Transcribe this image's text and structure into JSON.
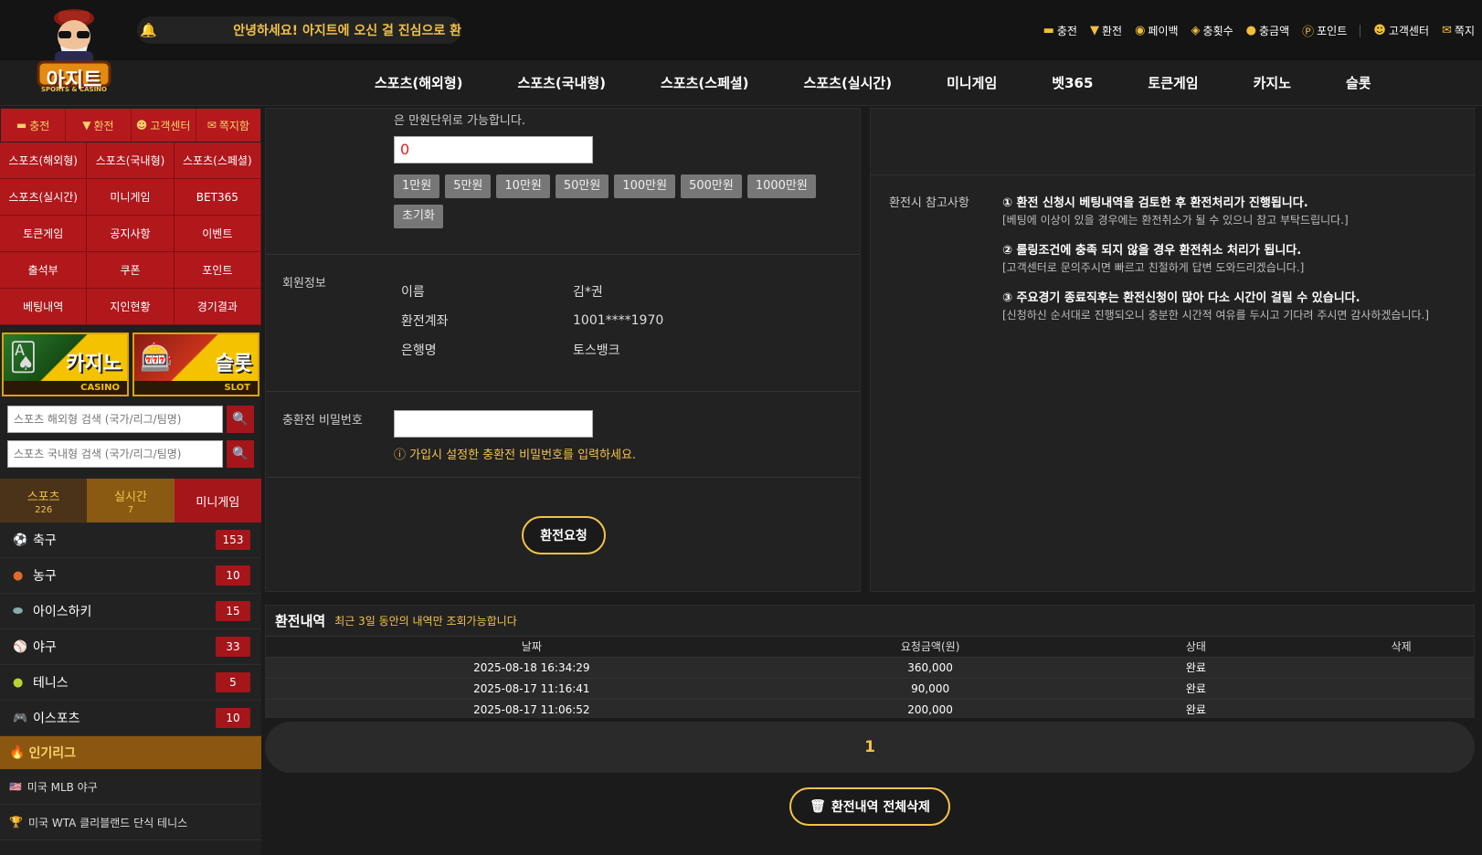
{
  "header": {
    "logo_text": "아지트",
    "logo_sub": "SPORTS & CASINO",
    "notice": "안녕하세요! 아지트에 오신 걸 진심으로 환",
    "top_links": [
      {
        "label": "충전",
        "icon": "card-icon"
      },
      {
        "label": "환전",
        "icon": "exchange-icon"
      },
      {
        "label": "페이백",
        "icon": "payback-icon"
      },
      {
        "label": "충횟수",
        "icon": "count-icon"
      },
      {
        "label": "충금액",
        "icon": "coins-icon"
      },
      {
        "label": "포인트",
        "icon": "point-icon"
      },
      {
        "label": "고객센터",
        "icon": "support-icon"
      },
      {
        "label": "쪽지",
        "icon": "message-icon"
      }
    ]
  },
  "nav": [
    "스포츠(해외형)",
    "스포츠(국내형)",
    "스포츠(스페셜)",
    "스포츠(실시간)",
    "미니게임",
    "벳365",
    "토큰게임",
    "카지노",
    "슬롯"
  ],
  "sidebar": {
    "quick": [
      "충전",
      "환전",
      "고객센터",
      "쪽지함"
    ],
    "menu": [
      "스포츠(해외형)",
      "스포츠(국내형)",
      "스포츠(스페셜)",
      "스포츠(실시간)",
      "미니게임",
      "BET365",
      "토큰게임",
      "공지사항",
      "이벤트",
      "출석부",
      "쿠폰",
      "포인트",
      "베팅내역",
      "지인현황",
      "경기결과"
    ],
    "banner_casino": {
      "title": "카지노",
      "sub": "CASINO"
    },
    "banner_slot": {
      "title": "슬롯",
      "sub": "SLOT"
    },
    "search_overseas_placeholder": "스포츠 해외형 검색 (국가/리그/팀명)",
    "search_domestic_placeholder": "스포츠 국내형 검색 (국가/리그/팀명)",
    "tabs": [
      {
        "label": "스포츠",
        "count": "226"
      },
      {
        "label": "실시간",
        "count": "7"
      },
      {
        "label": "미니게임",
        "count": ""
      }
    ],
    "sports": [
      {
        "name": "축구",
        "count": "153"
      },
      {
        "name": "농구",
        "count": "10"
      },
      {
        "name": "아이스하키",
        "count": "15"
      },
      {
        "name": "야구",
        "count": "33"
      },
      {
        "name": "테니스",
        "count": "5"
      },
      {
        "name": "이스포츠",
        "count": "10"
      }
    ],
    "popular_title": "인기리그",
    "leagues": [
      "미국 MLB 야구",
      "미국 WTA 클리블랜드 단식 테니스"
    ]
  },
  "form": {
    "note_top": "은 만원단위로 가능합니다.",
    "amount_value": "0",
    "chips": [
      "1만원",
      "5만원",
      "10만원",
      "50만원",
      "100만원",
      "500만원",
      "1000만원"
    ],
    "reset_label": "초기화",
    "member_label": "회원정보",
    "member": [
      {
        "k": "이름",
        "v": "김*권"
      },
      {
        "k": "환전계좌",
        "v": "1001****1970"
      },
      {
        "k": "은행명",
        "v": "토스뱅크"
      }
    ],
    "password_label": "충환전 비밀번호",
    "password_hint": "ⓘ 가입시 설정한 충환전 비밀번호를 입력하세요.",
    "submit_label": "환전요청"
  },
  "notes": {
    "label": "환전시 참고사항",
    "items": [
      {
        "t": "① 환전 신청시 베팅내역을 검토한 후 환전처리가 진행됩니다.",
        "s": "[베팅에 이상이 있을 경우에는 환전취소가 될 수 있으니 참고 부탁드립니다.]"
      },
      {
        "t": "② 롤링조건에 충족 되지 않을 경우 환전취소 처리가 됩니다.",
        "s": "[고객센터로 문의주시면 빠르고 친절하게 답변 도와드리겠습니다.]"
      },
      {
        "t": "③ 주요경기 종료직후는 환전신청이 많아 다소 시간이 걸릴 수 있습니다.",
        "s": "[신청하신 순서대로 진행되오니 충분한 시간적 여유를 두시고 기다려 주시면 감사하겠습니다.]"
      }
    ]
  },
  "history": {
    "title": "환전내역",
    "subtitle": "최근 3일 동안의 내역만 조회가능합니다",
    "columns": [
      "날짜",
      "요청금액(원)",
      "상태",
      "삭제"
    ],
    "rows": [
      {
        "date": "2025-08-18 16:34:29",
        "amount": "360,000",
        "status": "완료"
      },
      {
        "date": "2025-08-17 11:16:41",
        "amount": "90,000",
        "status": "완료"
      },
      {
        "date": "2025-08-17 11:06:52",
        "amount": "200,000",
        "status": "완료"
      }
    ],
    "page": "1",
    "delete_all_label": "환전내역 전체삭제"
  }
}
